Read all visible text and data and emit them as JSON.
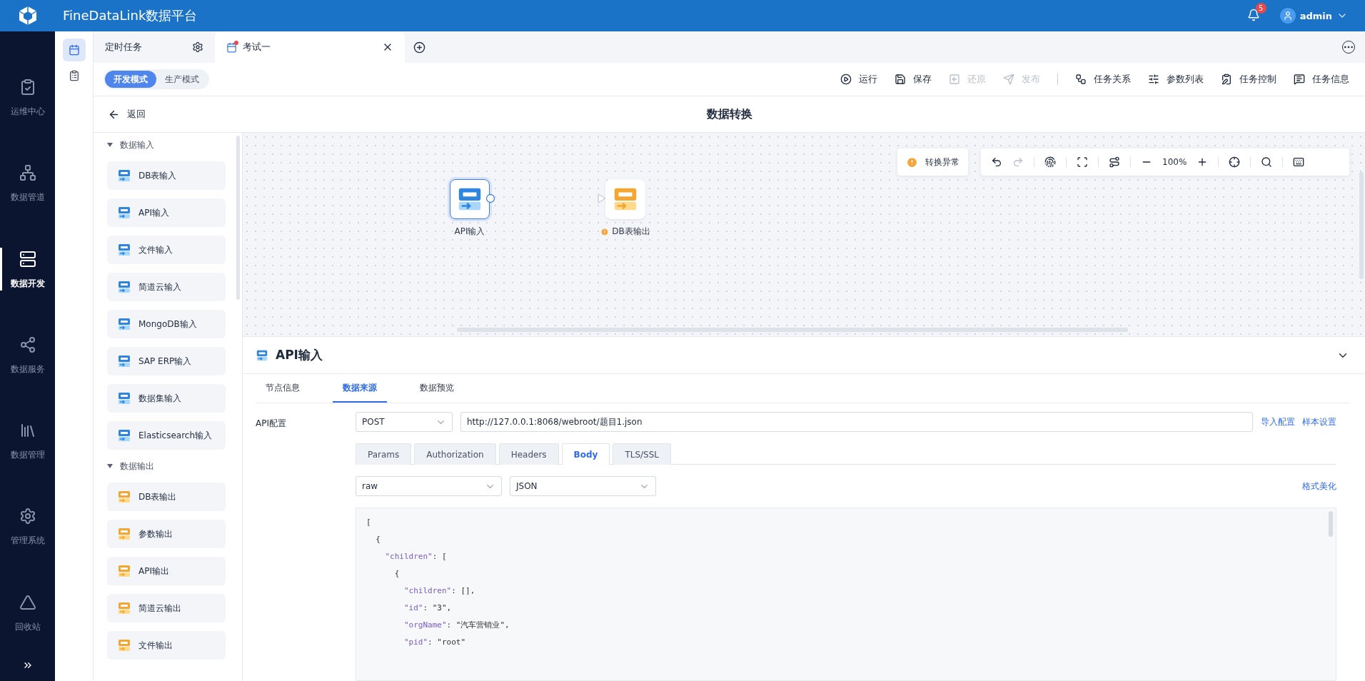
{
  "app": {
    "title": "FineDataLink数据平台",
    "notifications": "5",
    "user": "admin"
  },
  "nav": [
    {
      "label": "运维中心",
      "selected": false
    },
    {
      "label": "数据管道",
      "selected": false
    },
    {
      "label": "数据开发",
      "selected": true
    },
    {
      "label": "数据服务",
      "selected": false
    },
    {
      "label": "数据管理",
      "selected": false
    },
    {
      "label": "管理系统",
      "selected": false
    },
    {
      "label": "回收站",
      "selected": false
    }
  ],
  "rail": [
    {
      "selected": true
    },
    {
      "selected": false
    }
  ],
  "tabs": [
    {
      "label": "定时任务",
      "selected": false,
      "kind": "settings"
    },
    {
      "label": "考试一",
      "selected": true,
      "kind": "closable"
    }
  ],
  "modes": [
    {
      "label": "开发模式",
      "selected": true
    },
    {
      "label": "生产模式",
      "selected": false
    }
  ],
  "actions": [
    {
      "label": "运行",
      "disabled": false
    },
    {
      "label": "保存",
      "disabled": false
    },
    {
      "label": "还原",
      "disabled": true
    },
    {
      "label": "发布",
      "disabled": true
    },
    {
      "label": "任务关系",
      "disabled": false
    },
    {
      "label": "参数列表",
      "disabled": false
    },
    {
      "label": "任务控制",
      "disabled": false
    },
    {
      "label": "任务信息",
      "disabled": false
    }
  ],
  "back": "返回",
  "page_title": "数据转换",
  "palette": [
    {
      "title": "数据输入",
      "kind": "input",
      "expanded": true,
      "items": [
        "DB表输入",
        "API输入",
        "文件输入",
        "简道云输入",
        "MongoDB输入",
        "SAP ERP输入",
        "数据集输入",
        "Elasticsearch输入"
      ]
    },
    {
      "title": "数据输出",
      "kind": "output",
      "expanded": true,
      "items": [
        "DB表输出",
        "参数输出",
        "API输出",
        "简道云输出",
        "文件输出"
      ]
    }
  ],
  "canvas": {
    "status": "转换异常",
    "zoom": "100%",
    "nodes": [
      {
        "label": "API输入",
        "kind": "input",
        "selected": true,
        "warning": false
      },
      {
        "label": "DB表输出",
        "kind": "output",
        "selected": false,
        "warning": true
      }
    ]
  },
  "detail": {
    "title": "API输入",
    "tabs": [
      {
        "label": "节点信息",
        "selected": false
      },
      {
        "label": "数据来源",
        "selected": true
      },
      {
        "label": "数据预览",
        "selected": false
      }
    ],
    "config_label": "API配置",
    "method": "POST",
    "url": "http://127.0.0.1:8068/webroot/题目1.json",
    "links": [
      "导入配置",
      "样本设置"
    ],
    "body_tabs": [
      {
        "label": "Params",
        "selected": false
      },
      {
        "label": "Authorization",
        "selected": false
      },
      {
        "label": "Headers",
        "selected": false
      },
      {
        "label": "Body",
        "selected": true
      },
      {
        "label": "TLS/SSL",
        "selected": false
      }
    ],
    "body_type": "raw",
    "format": "JSON",
    "beautify": "格式美化",
    "code": [
      "[",
      "  {",
      "    \"children\": [",
      "      {",
      "        \"children\": [],",
      "        \"id\": \"3\",",
      "        \"orgName\": \"汽车营销业\",",
      "        \"pid\": \"root\""
    ]
  }
}
